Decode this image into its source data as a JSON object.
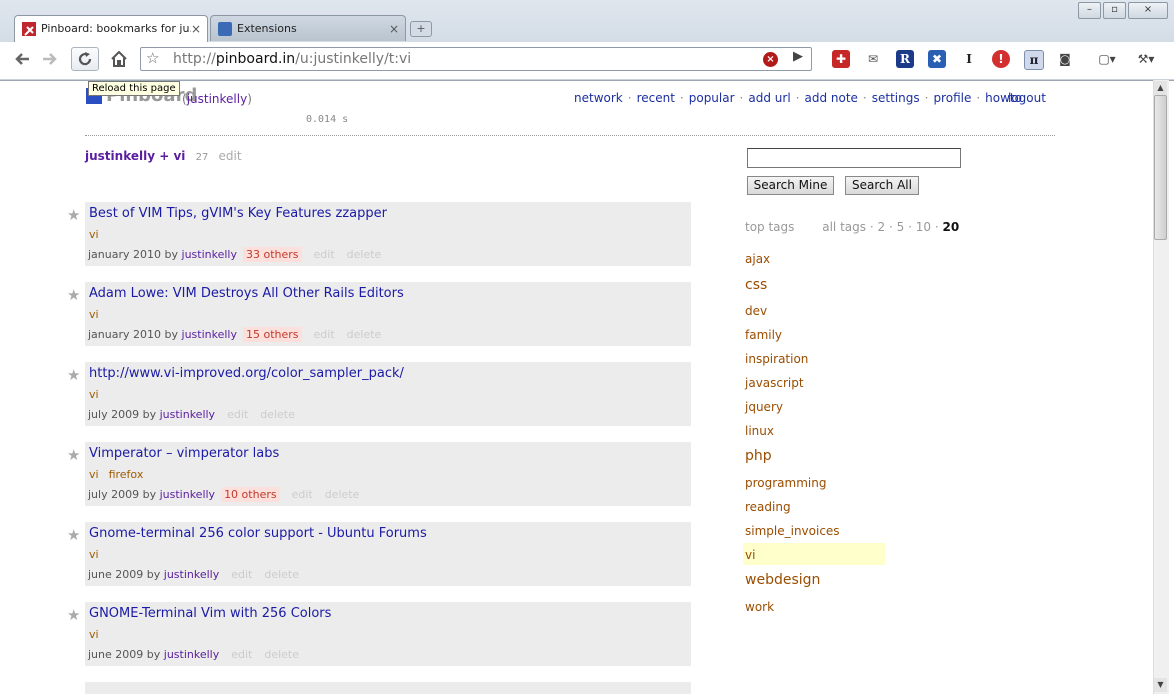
{
  "browser": {
    "tabs": [
      {
        "label": "Pinboard: bookmarks for ju…",
        "active": true
      },
      {
        "label": "Extensions",
        "active": false
      }
    ],
    "url_prefix": "http://",
    "url_host": "pinboard.in",
    "url_path": "/u:justinkelly/t:vi",
    "tooltip": "Reload this page"
  },
  "site": {
    "logo_text": "Pinboard",
    "user_paren_open": "(",
    "user": "justinkelly",
    "user_paren_close": ")",
    "timing": "0.014 s",
    "nav": [
      "network",
      "recent",
      "popular",
      "add url",
      "add note",
      "settings",
      "profile",
      "howto"
    ],
    "logout": "logout"
  },
  "filter": {
    "user": "justinkelly",
    "plus": "+",
    "tag": "vi",
    "count": "27",
    "edit": "edit"
  },
  "search": {
    "mine": "Search Mine",
    "all": "Search All",
    "value": ""
  },
  "tags_header": {
    "top": "top tags",
    "all": "all tags",
    "dot": "·",
    "n1": "2",
    "n2": "5",
    "n3": "10",
    "n4": "20"
  },
  "bookmarks": [
    {
      "title": "Best of VIM Tips, gVIM's Key Features zzapper",
      "tags": [
        "vi"
      ],
      "date": "january 2010",
      "by": "by",
      "user": "justinkelly",
      "others": "33 others",
      "edit": "edit",
      "delete": "delete"
    },
    {
      "title": "Adam Lowe: VIM Destroys All Other Rails Editors",
      "tags": [
        "vi"
      ],
      "date": "january 2010",
      "by": "by",
      "user": "justinkelly",
      "others": "15 others",
      "edit": "edit",
      "delete": "delete"
    },
    {
      "title": "http://www.vi-improved.org/color_sampler_pack/",
      "tags": [
        "vi"
      ],
      "date": "july 2009",
      "by": "by",
      "user": "justinkelly",
      "others": "",
      "edit": "edit",
      "delete": "delete"
    },
    {
      "title": "Vimperator – vimperator labs",
      "tags": [
        "vi",
        "firefox"
      ],
      "date": "july 2009",
      "by": "by",
      "user": "justinkelly",
      "others": "10 others",
      "edit": "edit",
      "delete": "delete"
    },
    {
      "title": "Gnome-terminal 256 color support - Ubuntu Forums",
      "tags": [
        "vi"
      ],
      "date": "june 2009",
      "by": "by",
      "user": "justinkelly",
      "others": "",
      "edit": "edit",
      "delete": "delete"
    },
    {
      "title": "GNOME-Terminal Vim with 256 Colors",
      "tags": [
        "vi"
      ],
      "date": "june 2009",
      "by": "by",
      "user": "justinkelly",
      "others": "",
      "edit": "edit",
      "delete": "delete"
    }
  ],
  "tags": [
    "ajax",
    "css",
    "dev",
    "family",
    "inspiration",
    "javascript",
    "jquery",
    "linux",
    "php",
    "programming",
    "reading",
    "simple_invoices",
    "vi",
    "webdesign",
    "work"
  ],
  "colors": {
    "link": "#1c2fa0",
    "tag": "#9a4d00",
    "user": "#5a1ea0",
    "highlight": "#ffffcc"
  }
}
